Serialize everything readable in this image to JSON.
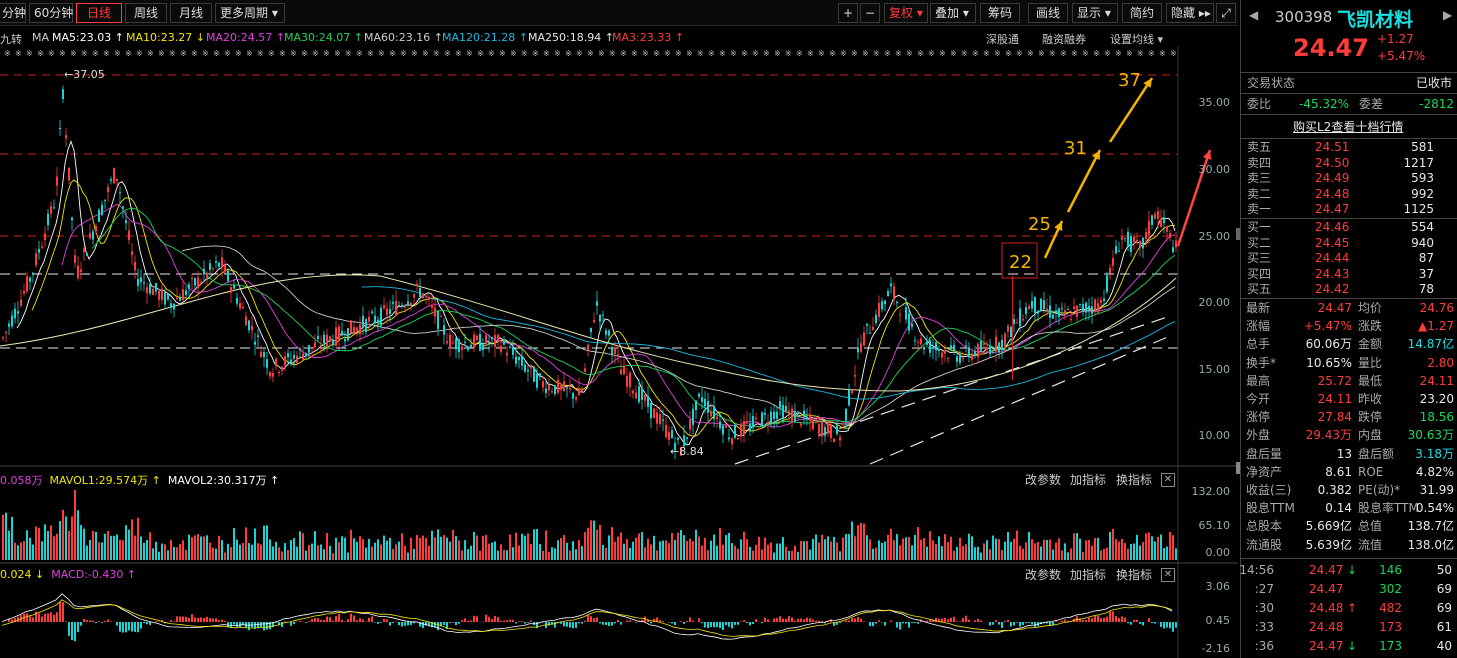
{
  "toolbar": {
    "period_buttons": [
      "分钟",
      "60分钟",
      "日线",
      "周线",
      "月线",
      "更多周期 ▾"
    ],
    "active_period": "日线",
    "right_buttons": [
      "+",
      "−",
      "复权 ▾",
      "叠加 ▾",
      "筹码",
      "画线",
      "显示 ▾",
      "简约",
      "隐藏 ▸▸",
      "⤢"
    ]
  },
  "ma_line": {
    "prefix": "九转",
    "ma_label": "MA",
    "items": [
      {
        "text": "MA5:23.03 ↑",
        "color": "#ffffff"
      },
      {
        "text": "MA10:23.27 ↓",
        "color": "#f5e600"
      },
      {
        "text": "MA20:24.57 ↑",
        "color": "#e040e0"
      },
      {
        "text": "MA30:24.07 ↑",
        "color": "#19d65a"
      },
      {
        "text": "MA60:23.16 ↑",
        "color": "#cccccc"
      },
      {
        "text": "MA120:21.28 ↑",
        "color": "#19b8e0"
      },
      {
        "text": "MA250:18.94 ↑",
        "color": "#e8e8e8"
      },
      {
        "text": "MA3:23.33 ↑",
        "color": "#ff3b3b"
      }
    ],
    "links": [
      "深股通",
      "融资融券",
      "设置均线 ▾"
    ]
  },
  "price_axis": [
    "35.00",
    "30.00",
    "25.00",
    "20.00",
    "15.00",
    "10.00"
  ],
  "annotations": {
    "high": "37.05",
    "low": "8.84",
    "targets": [
      "22",
      "25",
      "31",
      "37"
    ]
  },
  "volume": {
    "title_items": [
      {
        "text": "0.058万",
        "color": "#e040e0"
      },
      {
        "text": "MAVOL1:29.574万 ↑",
        "color": "#f5e600"
      },
      {
        "text": "MAVOL2:30.317万 ↑",
        "color": "#ffffff"
      }
    ],
    "axis": [
      "132.00",
      "65.10",
      "0.00"
    ],
    "buttons": [
      "改参数",
      "加指标",
      "换指标"
    ]
  },
  "macd": {
    "title_items": [
      {
        "text": "0.024 ↓",
        "color": "#f5e600"
      },
      {
        "text": "MACD:-0.430 ↑",
        "color": "#e040e0"
      }
    ],
    "axis": [
      "3.06",
      "0.45",
      "-2.16"
    ],
    "buttons": [
      "改参数",
      "加指标",
      "换指标"
    ]
  },
  "panel": {
    "code": "300398",
    "name": "飞凯材料",
    "price": "24.47",
    "change": "+1.27",
    "change_pct": "+5.47%",
    "trade_state_label": "交易状态",
    "trade_state": "已收市",
    "weibi_label": "委比",
    "weibi": "-45.32%",
    "weicha_label": "委差",
    "weicha": "-2812",
    "l2_link": "购买L2查看十档行情",
    "asks": [
      {
        "label": "卖五",
        "price": "24.51",
        "vol": "581"
      },
      {
        "label": "卖四",
        "price": "24.50",
        "vol": "1217"
      },
      {
        "label": "卖三",
        "price": "24.49",
        "vol": "593"
      },
      {
        "label": "卖二",
        "price": "24.48",
        "vol": "992"
      },
      {
        "label": "卖一",
        "price": "24.47",
        "vol": "1125"
      }
    ],
    "bids": [
      {
        "label": "买一",
        "price": "24.46",
        "vol": "554"
      },
      {
        "label": "买二",
        "price": "24.45",
        "vol": "940"
      },
      {
        "label": "买三",
        "price": "24.44",
        "vol": "87"
      },
      {
        "label": "买四",
        "price": "24.43",
        "vol": "37"
      },
      {
        "label": "买五",
        "price": "24.42",
        "vol": "78"
      }
    ],
    "stats": [
      {
        "l1": "最新",
        "v1": "24.47",
        "c1": "red",
        "l2": "均价",
        "v2": "24.76",
        "c2": "red"
      },
      {
        "l1": "涨幅",
        "v1": "+5.47%",
        "c1": "red",
        "l2": "涨跌",
        "v2": "▲1.27",
        "c2": "red"
      },
      {
        "l1": "总手",
        "v1": "60.06万",
        "c1": "wht",
        "l2": "金额",
        "v2": "14.87亿",
        "c2": "cyan"
      },
      {
        "l1": "换手*",
        "v1": "10.65%",
        "c1": "wht",
        "l2": "量比",
        "v2": "2.80",
        "c2": "red"
      },
      {
        "l1": "最高",
        "v1": "25.72",
        "c1": "red",
        "l2": "最低",
        "v2": "24.11",
        "c2": "red"
      },
      {
        "l1": "今开",
        "v1": "24.11",
        "c1": "red",
        "l2": "昨收",
        "v2": "23.20",
        "c2": "wht"
      },
      {
        "l1": "涨停",
        "v1": "27.84",
        "c1": "red",
        "l2": "跌停",
        "v2": "18.56",
        "c2": "grn"
      },
      {
        "l1": "外盘",
        "v1": "29.43万",
        "c1": "red",
        "l2": "内盘",
        "v2": "30.63万",
        "c2": "grn"
      },
      {
        "l1": "盘后量",
        "v1": "13",
        "c1": "wht",
        "l2": "盘后额",
        "v2": "3.18万",
        "c2": "cyan"
      },
      {
        "l1": "净资产",
        "v1": "8.61",
        "c1": "wht",
        "l2": "ROE",
        "v2": "4.82%",
        "c2": "wht"
      },
      {
        "l1": "收益(三)",
        "v1": "0.382",
        "c1": "wht",
        "l2": "PE(动)*",
        "v2": "31.99",
        "c2": "wht"
      },
      {
        "l1": "股息TTM",
        "v1": "0.14",
        "c1": "wht",
        "l2": "股息率TTM",
        "v2": "0.54%",
        "c2": "wht"
      },
      {
        "l1": "总股本",
        "v1": "5.669亿",
        "c1": "wht",
        "l2": "总值",
        "v2": "138.7亿",
        "c2": "wht"
      },
      {
        "l1": "流通股",
        "v1": "5.639亿",
        "c1": "wht",
        "l2": "流值",
        "v2": "138.0亿",
        "c2": "wht"
      }
    ],
    "ticks": [
      {
        "time": "14:56",
        "price": "24.47",
        "arrow": "↓",
        "arrow_color": "grn",
        "vol": "146",
        "vol_color": "grn",
        "n": "50"
      },
      {
        "time": ":27",
        "price": "24.47",
        "arrow": "",
        "arrow_color": "grn",
        "vol": "302",
        "vol_color": "grn",
        "n": "69"
      },
      {
        "time": ":30",
        "price": "24.48",
        "arrow": "↑",
        "arrow_color": "red",
        "vol": "482",
        "vol_color": "red",
        "n": "69"
      },
      {
        "time": ":33",
        "price": "24.48",
        "arrow": "",
        "arrow_color": "red",
        "vol": "173",
        "vol_color": "red",
        "n": "61"
      },
      {
        "time": ":36",
        "price": "24.47",
        "arrow": "↓",
        "arrow_color": "grn",
        "vol": "173",
        "vol_color": "grn",
        "n": "40"
      }
    ]
  }
}
